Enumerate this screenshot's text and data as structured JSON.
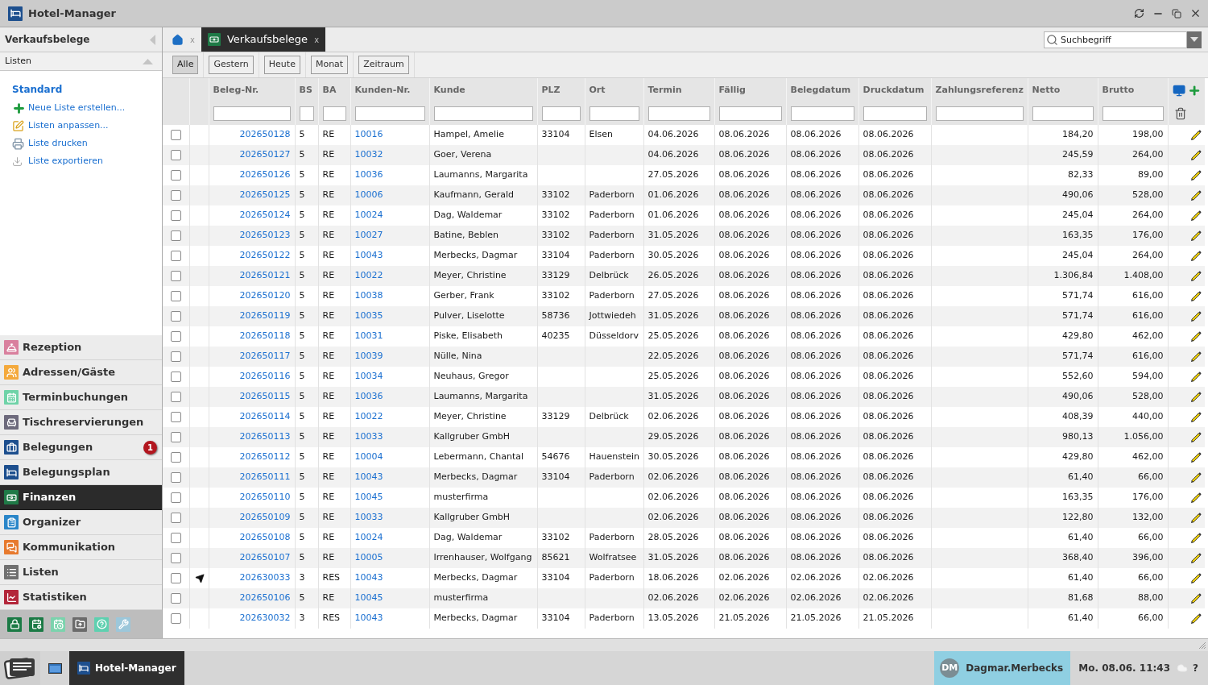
{
  "window": {
    "title": "Hotel-Manager"
  },
  "sidebar": {
    "title": "Verkaufsbelege",
    "section": {
      "label": "Listen",
      "expanded": true
    },
    "list_heading": "Standard",
    "actions": [
      "Neue Liste erstellen...",
      "Listen anpassen...",
      "Liste drucken",
      "Liste exportieren"
    ],
    "nav": [
      {
        "label": "Rezeption",
        "selected": false
      },
      {
        "label": "Adressen/Gäste",
        "selected": false
      },
      {
        "label": "Terminbuchungen",
        "selected": false
      },
      {
        "label": "Tischreservierungen",
        "selected": false
      },
      {
        "label": "Belegungen",
        "selected": false,
        "badge": "1"
      },
      {
        "label": "Belegungsplan",
        "selected": false
      },
      {
        "label": "Finanzen",
        "selected": true
      },
      {
        "label": "Organizer",
        "selected": false
      },
      {
        "label": "Kommunikation",
        "selected": false
      },
      {
        "label": "Listen",
        "selected": false
      },
      {
        "label": "Statistiken",
        "selected": false
      }
    ]
  },
  "tabs": [
    {
      "kind": "home",
      "close": "x",
      "selected": false
    },
    {
      "kind": "page",
      "label": "Verkaufsbelege",
      "close": "x",
      "selected": true
    }
  ],
  "search": {
    "placeholder": "Suchbegriff"
  },
  "filters": [
    {
      "label": "Alle",
      "selected": true
    },
    {
      "label": "Gestern",
      "selected": false
    },
    {
      "label": "Heute",
      "selected": false
    },
    {
      "label": "Monat",
      "selected": false
    },
    {
      "label": "Zeitraum",
      "selected": false
    }
  ],
  "table": {
    "columns": [
      "Beleg-Nr.",
      "BS",
      "BA",
      "Kunden-Nr.",
      "Kunde",
      "PLZ",
      "Ort",
      "Termin",
      "Fällig",
      "Belegdatum",
      "Druckdatum",
      "Zahlungsreferenz",
      "Netto",
      "Brutto"
    ],
    "rows": [
      {
        "checked": false,
        "sent": false,
        "beleg_nr": "202650128",
        "bs": "5",
        "ba": "RE",
        "kunden_nr": "10016",
        "kunde": "Hampel, Amelie",
        "plz": "33104",
        "ort": "Elsen",
        "termin": "04.06.2026",
        "faellig": "08.06.2026",
        "belegdatum": "08.06.2026",
        "druckdatum": "08.06.2026",
        "netto": "184,20",
        "brutto": "198,00"
      },
      {
        "checked": false,
        "sent": false,
        "beleg_nr": "202650127",
        "bs": "5",
        "ba": "RE",
        "kunden_nr": "10032",
        "kunde": "Goer, Verena",
        "termin": "04.06.2026",
        "faellig": "08.06.2026",
        "belegdatum": "08.06.2026",
        "druckdatum": "08.06.2026",
        "netto": "245,59",
        "brutto": "264,00"
      },
      {
        "checked": false,
        "sent": false,
        "beleg_nr": "202650126",
        "bs": "5",
        "ba": "RE",
        "kunden_nr": "10036",
        "kunde": "Laumanns, Margarita",
        "termin": "27.05.2026",
        "faellig": "08.06.2026",
        "belegdatum": "08.06.2026",
        "druckdatum": "08.06.2026",
        "netto": "82,33",
        "brutto": "89,00"
      },
      {
        "checked": false,
        "sent": false,
        "beleg_nr": "202650125",
        "bs": "5",
        "ba": "RE",
        "kunden_nr": "10006",
        "kunde": "Kaufmann, Gerald",
        "plz": "33102",
        "ort": "Paderborn",
        "termin": "01.06.2026",
        "faellig": "08.06.2026",
        "belegdatum": "08.06.2026",
        "druckdatum": "08.06.2026",
        "netto": "490,06",
        "brutto": "528,00"
      },
      {
        "checked": false,
        "sent": false,
        "beleg_nr": "202650124",
        "bs": "5",
        "ba": "RE",
        "kunden_nr": "10024",
        "kunde": "Dag, Waldemar",
        "plz": "33102",
        "ort": "Paderborn",
        "termin": "01.06.2026",
        "faellig": "08.06.2026",
        "belegdatum": "08.06.2026",
        "druckdatum": "08.06.2026",
        "netto": "245,04",
        "brutto": "264,00"
      },
      {
        "checked": false,
        "sent": false,
        "beleg_nr": "202650123",
        "bs": "5",
        "ba": "RE",
        "kunden_nr": "10027",
        "kunde": "Batine, Beblen",
        "plz": "33102",
        "ort": "Paderborn",
        "termin": "31.05.2026",
        "faellig": "08.06.2026",
        "belegdatum": "08.06.2026",
        "druckdatum": "08.06.2026",
        "netto": "163,35",
        "brutto": "176,00"
      },
      {
        "checked": false,
        "sent": false,
        "beleg_nr": "202650122",
        "bs": "5",
        "ba": "RE",
        "kunden_nr": "10043",
        "kunde": "Merbecks, Dagmar",
        "plz": "33104",
        "ort": "Paderborn",
        "termin": "30.05.2026",
        "faellig": "08.06.2026",
        "belegdatum": "08.06.2026",
        "druckdatum": "08.06.2026",
        "netto": "245,04",
        "brutto": "264,00"
      },
      {
        "checked": false,
        "sent": false,
        "beleg_nr": "202650121",
        "bs": "5",
        "ba": "RE",
        "kunden_nr": "10022",
        "kunde": "Meyer, Christine",
        "plz": "33129",
        "ort": "Delbrück",
        "termin": "26.05.2026",
        "faellig": "08.06.2026",
        "belegdatum": "08.06.2026",
        "druckdatum": "08.06.2026",
        "netto": "1.306,84",
        "brutto": "1.408,00"
      },
      {
        "checked": false,
        "sent": false,
        "beleg_nr": "202650120",
        "bs": "5",
        "ba": "RE",
        "kunden_nr": "10038",
        "kunde": "Gerber, Frank",
        "plz": "33102",
        "ort": "Paderborn",
        "termin": "27.05.2026",
        "faellig": "08.06.2026",
        "belegdatum": "08.06.2026",
        "druckdatum": "08.06.2026",
        "netto": "571,74",
        "brutto": "616,00"
      },
      {
        "checked": false,
        "sent": false,
        "beleg_nr": "202650119",
        "bs": "5",
        "ba": "RE",
        "kunden_nr": "10035",
        "kunde": "Pulver, Liselotte",
        "plz": "58736",
        "ort": "Jottwiedeh",
        "termin": "31.05.2026",
        "faellig": "08.06.2026",
        "belegdatum": "08.06.2026",
        "druckdatum": "08.06.2026",
        "netto": "571,74",
        "brutto": "616,00"
      },
      {
        "checked": false,
        "sent": false,
        "beleg_nr": "202650118",
        "bs": "5",
        "ba": "RE",
        "kunden_nr": "10031",
        "kunde": "Piske, Elisabeth",
        "plz": "40235",
        "ort": "Düsseldorv",
        "termin": "25.05.2026",
        "faellig": "08.06.2026",
        "belegdatum": "08.06.2026",
        "druckdatum": "08.06.2026",
        "netto": "429,80",
        "brutto": "462,00"
      },
      {
        "checked": false,
        "sent": false,
        "beleg_nr": "202650117",
        "bs": "5",
        "ba": "RE",
        "kunden_nr": "10039",
        "kunde": "Nülle, Nina",
        "termin": "22.05.2026",
        "faellig": "08.06.2026",
        "belegdatum": "08.06.2026",
        "druckdatum": "08.06.2026",
        "netto": "571,74",
        "brutto": "616,00"
      },
      {
        "checked": false,
        "sent": false,
        "beleg_nr": "202650116",
        "bs": "5",
        "ba": "RE",
        "kunden_nr": "10034",
        "kunde": "Neuhaus, Gregor",
        "termin": "25.05.2026",
        "faellig": "08.06.2026",
        "belegdatum": "08.06.2026",
        "druckdatum": "08.06.2026",
        "netto": "552,60",
        "brutto": "594,00"
      },
      {
        "checked": false,
        "sent": false,
        "beleg_nr": "202650115",
        "bs": "5",
        "ba": "RE",
        "kunden_nr": "10036",
        "kunde": "Laumanns, Margarita",
        "termin": "31.05.2026",
        "faellig": "08.06.2026",
        "belegdatum": "08.06.2026",
        "druckdatum": "08.06.2026",
        "netto": "490,06",
        "brutto": "528,00"
      },
      {
        "checked": false,
        "sent": false,
        "beleg_nr": "202650114",
        "bs": "5",
        "ba": "RE",
        "kunden_nr": "10022",
        "kunde": "Meyer, Christine",
        "plz": "33129",
        "ort": "Delbrück",
        "termin": "02.06.2026",
        "faellig": "08.06.2026",
        "belegdatum": "08.06.2026",
        "druckdatum": "08.06.2026",
        "netto": "408,39",
        "brutto": "440,00"
      },
      {
        "checked": false,
        "sent": false,
        "beleg_nr": "202650113",
        "bs": "5",
        "ba": "RE",
        "kunden_nr": "10033",
        "kunde": "Kallgruber GmbH",
        "termin": "29.05.2026",
        "faellig": "08.06.2026",
        "belegdatum": "08.06.2026",
        "druckdatum": "08.06.2026",
        "netto": "980,13",
        "brutto": "1.056,00"
      },
      {
        "checked": false,
        "sent": false,
        "beleg_nr": "202650112",
        "bs": "5",
        "ba": "RE",
        "kunden_nr": "10004",
        "kunde": "Lebermann, Chantal",
        "plz": "54676",
        "ort": "Hauenstein",
        "termin": "30.05.2026",
        "faellig": "08.06.2026",
        "belegdatum": "08.06.2026",
        "druckdatum": "08.06.2026",
        "netto": "429,80",
        "brutto": "462,00"
      },
      {
        "checked": false,
        "sent": false,
        "beleg_nr": "202650111",
        "bs": "5",
        "ba": "RE",
        "kunden_nr": "10043",
        "kunde": "Merbecks, Dagmar",
        "plz": "33104",
        "ort": "Paderborn",
        "termin": "02.06.2026",
        "faellig": "08.06.2026",
        "belegdatum": "08.06.2026",
        "druckdatum": "08.06.2026",
        "netto": "61,40",
        "brutto": "66,00"
      },
      {
        "checked": false,
        "sent": false,
        "beleg_nr": "202650110",
        "bs": "5",
        "ba": "RE",
        "kunden_nr": "10045",
        "kunde": "musterfirma",
        "termin": "02.06.2026",
        "faellig": "08.06.2026",
        "belegdatum": "08.06.2026",
        "druckdatum": "08.06.2026",
        "netto": "163,35",
        "brutto": "176,00"
      },
      {
        "checked": false,
        "sent": false,
        "beleg_nr": "202650109",
        "bs": "5",
        "ba": "RE",
        "kunden_nr": "10033",
        "kunde": "Kallgruber GmbH",
        "termin": "02.06.2026",
        "faellig": "08.06.2026",
        "belegdatum": "08.06.2026",
        "druckdatum": "08.06.2026",
        "netto": "122,80",
        "brutto": "132,00"
      },
      {
        "checked": false,
        "sent": false,
        "beleg_nr": "202650108",
        "bs": "5",
        "ba": "RE",
        "kunden_nr": "10024",
        "kunde": "Dag, Waldemar",
        "plz": "33102",
        "ort": "Paderborn",
        "termin": "28.05.2026",
        "faellig": "08.06.2026",
        "belegdatum": "08.06.2026",
        "druckdatum": "08.06.2026",
        "netto": "61,40",
        "brutto": "66,00"
      },
      {
        "checked": false,
        "sent": false,
        "beleg_nr": "202650107",
        "bs": "5",
        "ba": "RE",
        "kunden_nr": "10005",
        "kunde": "Irrenhauser, Wolfgang",
        "plz": "85621",
        "ort": "Wolfratsee",
        "termin": "31.05.2026",
        "faellig": "08.06.2026",
        "belegdatum": "08.06.2026",
        "druckdatum": "08.06.2026",
        "netto": "368,40",
        "brutto": "396,00"
      },
      {
        "checked": false,
        "sent": true,
        "beleg_nr": "202630033",
        "bs": "3",
        "ba": "RES",
        "kunden_nr": "10043",
        "kunde": "Merbecks, Dagmar",
        "plz": "33104",
        "ort": "Paderborn",
        "termin": "18.06.2026",
        "faellig": "02.06.2026",
        "belegdatum": "02.06.2026",
        "druckdatum": "02.06.2026",
        "netto": "61,40",
        "brutto": "66,00"
      },
      {
        "checked": false,
        "sent": false,
        "beleg_nr": "202650106",
        "bs": "5",
        "ba": "RE",
        "kunden_nr": "10045",
        "kunde": "musterfirma",
        "termin": "02.06.2026",
        "faellig": "02.06.2026",
        "belegdatum": "02.06.2026",
        "druckdatum": "02.06.2026",
        "netto": "81,68",
        "brutto": "88,00"
      },
      {
        "checked": false,
        "sent": false,
        "beleg_nr": "202630032",
        "bs": "3",
        "ba": "RES",
        "kunden_nr": "10043",
        "kunde": "Merbecks, Dagmar",
        "plz": "33104",
        "ort": "Paderborn",
        "termin": "13.05.2026",
        "faellig": "21.05.2026",
        "belegdatum": "21.05.2026",
        "druckdatum": "21.05.2026",
        "netto": "61,40",
        "brutto": "66,00"
      }
    ]
  },
  "taskbar": {
    "tasks": [
      {
        "label": "Hotel-Manager",
        "selected": true
      }
    ],
    "user": {
      "initials": "DM",
      "name": "Dagmar.Merbecks"
    },
    "clock": "Mo. 08.06. 11:43",
    "help": "?"
  }
}
